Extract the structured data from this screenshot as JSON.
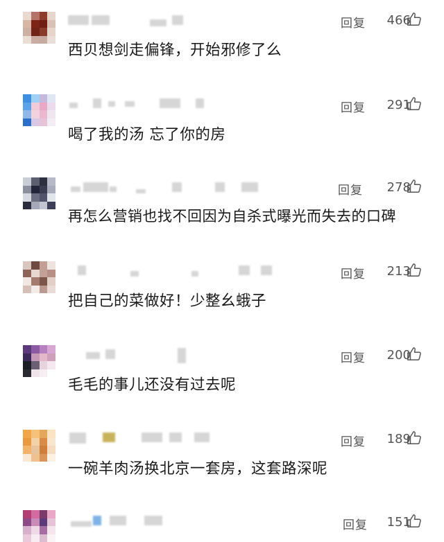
{
  "comments": [
    {
      "reply_label": "回复",
      "likes": "466",
      "text": "西贝想剑走偏锋，开始邪修了么",
      "avatar_colors": [
        "#e9d9cf",
        "#b5726a",
        "#8f3b2d",
        "#e6d6cb",
        "#d8b7a6",
        "#7d2416",
        "#6e1e12",
        "#d9c2b4",
        "#cdb0a3",
        "#712318",
        "#8a3a2a",
        "#e5d5cb",
        "#e9ddd4",
        "#c9aca2",
        "#c7aaa0",
        "#eadfd8"
      ]
    },
    {
      "reply_label": "回复",
      "likes": "291",
      "text": "喝了我的汤 忘了你的房",
      "avatar_colors": [
        "#3e8fe2",
        "#9fd0f6",
        "#c7b9dd",
        "#dfe6f4",
        "#5aa3ea",
        "#f1cbd7",
        "#e7a9c5",
        "#eadcec",
        "#8fb7e8",
        "#f3d2df",
        "#ecb8cf",
        "#f0e6f0",
        "#2c6fcb",
        "#d9c7e6",
        "#e8c2d7",
        "#f3eef4"
      ]
    },
    {
      "reply_label": "回复",
      "likes": "278",
      "text": "再怎么营销也找不回因为自杀式曝光而失去的口碑",
      "avatar_colors": [
        "#c9cdd6",
        "#5c5f70",
        "#2e3040",
        "#b7bac6",
        "#8c8fa0",
        "#23253a",
        "#3a3c52",
        "#a9adbb",
        "#d7d9e2",
        "#6b6e80",
        "#50536a",
        "#e3e5ec",
        "#2b2d3f",
        "#a4a8b8",
        "#c2c5d0",
        "#3c3f55"
      ]
    },
    {
      "reply_label": "回复",
      "likes": "213",
      "text": "把自己的菜做好！少整幺蛾子",
      "avatar_colors": [
        "#d9c6bf",
        "#6f4a40",
        "#c39e95",
        "#ede3df",
        "#8d645a",
        "#e8d7d1",
        "#c4a198",
        "#b78f85",
        "#f1e8e4",
        "#a57b70",
        "#7d564b",
        "#e2cfc8",
        "#d6bfb7",
        "#f2ebe8",
        "#bd9a91",
        "#e9dcd6"
      ]
    },
    {
      "reply_label": "回复",
      "likes": "200",
      "text": "毛毛的事儿还没有过去呢",
      "avatar_colors": [
        "#5d3a7c",
        "#8a5aa3",
        "#b67fc0",
        "#d7a6d3",
        "#3c2a5a",
        "#c799b9",
        "#e3b8c8",
        "#cfa0ba",
        "#1c1c24",
        "#6b5f73",
        "#e6d3dc",
        "#f4e8ee",
        "#2a2a30",
        "#f0e4ea",
        "#f6eef2",
        "#ffffff"
      ]
    },
    {
      "reply_label": "回复",
      "likes": "189",
      "text": "一碗羊肉汤换北京一套房，这套路深呢",
      "avatar_colors": [
        "#f1a64a",
        "#f6c27a",
        "#e4a85c",
        "#fbe3c4",
        "#e99a3f",
        "#f3d2a8",
        "#d98c47",
        "#f8e6cf",
        "#f3b36a",
        "#e7c49e",
        "#cf7f3b",
        "#f6dcc0",
        "#fae7d4",
        "#eec18f",
        "#d9955a",
        "#fdf1e4"
      ]
    },
    {
      "reply_label": "回复",
      "likes": "151",
      "text": "",
      "avatar_colors": [
        "#b33e76",
        "#d36aa0",
        "#7a3a6a",
        "#e9a9c6",
        "#8e4a88",
        "#c98bb8",
        "#5d3b7a",
        "#e7c3d7",
        "#d9b0cb",
        "#f0d9e6",
        "#a66ea2",
        "#f5e6ee",
        "#e9c9da",
        "#f7ecf2",
        "#dcbdd0",
        "#fbf4f7"
      ]
    }
  ]
}
